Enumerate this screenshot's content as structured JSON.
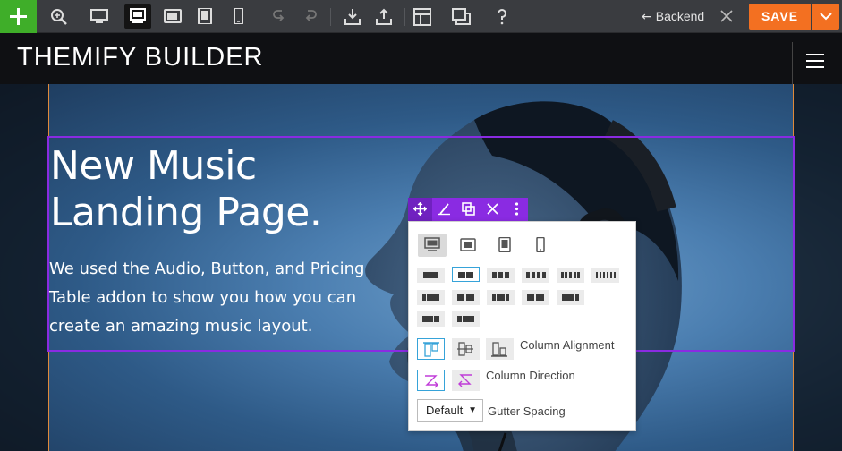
{
  "toolbar": {
    "buttons": [
      "add",
      "zoom",
      "desktop",
      "desktop-active",
      "tablet-landscape",
      "tablet",
      "mobile",
      "undo",
      "redo",
      "import",
      "export",
      "layouts",
      "duplicate",
      "help"
    ],
    "backend_label": "Backend",
    "save_label": "SAVE"
  },
  "site": {
    "title": "THEMIFY BUILDER"
  },
  "hero": {
    "heading": "New Music Landing Page.",
    "body": "We used the Audio, Button, and Pricing Table addon to show you how you can create an amazing music layout."
  },
  "panel": {
    "column_alignment_label": "Column Alignment",
    "column_direction_label": "Column Direction",
    "gutter_select_value": "Default",
    "gutter_label": "Gutter Spacing"
  },
  "colors": {
    "toolbar_bg": "#3a3c40",
    "add_green": "#3fae29",
    "save_orange": "#f37021",
    "row_purple": "#8a2be2",
    "selected_blue": "#36a3d9"
  }
}
